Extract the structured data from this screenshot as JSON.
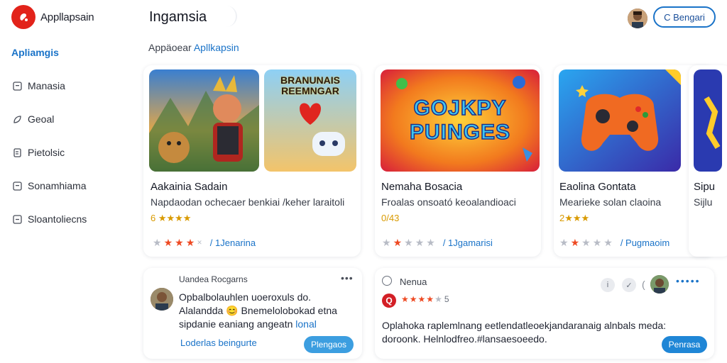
{
  "app": {
    "title": "Appllapsain"
  },
  "sidebar": {
    "heading": "Apliamgis",
    "items": [
      {
        "label": "Manasia",
        "icon": "square-icon"
      },
      {
        "label": "Geoal",
        "icon": "leaf-icon"
      },
      {
        "label": "Pietolsic",
        "icon": "document-icon"
      },
      {
        "label": "Sonamhiama",
        "icon": "square-icon"
      },
      {
        "label": "Sloantoliecns",
        "icon": "square-icon"
      }
    ]
  },
  "header": {
    "title": "Ingamsia",
    "button_label": "C Bengari"
  },
  "breadcrumb": {
    "prefix": "Appäoear",
    "link": "Apllkapsin"
  },
  "cards": [
    {
      "title": "Aakainia Sadain",
      "desc": "Napdaodan ochecaer benkiai /keher laraitoli",
      "score": "6 ★★★★",
      "stars_on": 3,
      "stars_total": 5,
      "rating_text": "/ 1Jenarina",
      "art_text": "BRANUNAIS REEMNGAR"
    },
    {
      "title": "Nemaha Bosacia",
      "desc": "Froalas onsoató keoalandioaci",
      "score": "0/43",
      "stars_on": 2,
      "stars_total": 5,
      "rating_text": "/ 1Jgamarisi",
      "art_text": "GOJKPY PUINGES"
    },
    {
      "title": "Eaolina Gontata",
      "desc": "Mearieke solan claoina",
      "score": "2★★★",
      "stars_on": 2,
      "stars_total": 5,
      "rating_text": "/ Pugmaoim",
      "art_text": ""
    },
    {
      "title": "Sipu",
      "desc": "Sijlu",
      "score": "",
      "stars_on": 0,
      "stars_total": 0,
      "rating_text": "",
      "art_text": ""
    }
  ],
  "panels": [
    {
      "user": "Uandea Rocgarns",
      "text_lines": [
        "Opbalbolauhlen uoeroxuls do.",
        "Alalandda 😊 Bnemelolobokad etna",
        "sipdanie eaniang angeatn"
      ],
      "highlight": "lonal",
      "link": "Loderlas beingurte",
      "button": "Plengaos"
    },
    {
      "user": "Nenua",
      "stars_on": 4,
      "stars_total": 5,
      "star_count": "5",
      "text_lines": [
        "Oplahoka raplemlnang eetlendatleoekjandaranaig alnbals meda:",
        "doroonk. Helnlodfreo.#lansaesoeedo."
      ],
      "button": "Penrasa"
    }
  ],
  "colors": {
    "accent": "#1a73c8",
    "star": "#ee4a23",
    "brand": "#e2231a"
  }
}
